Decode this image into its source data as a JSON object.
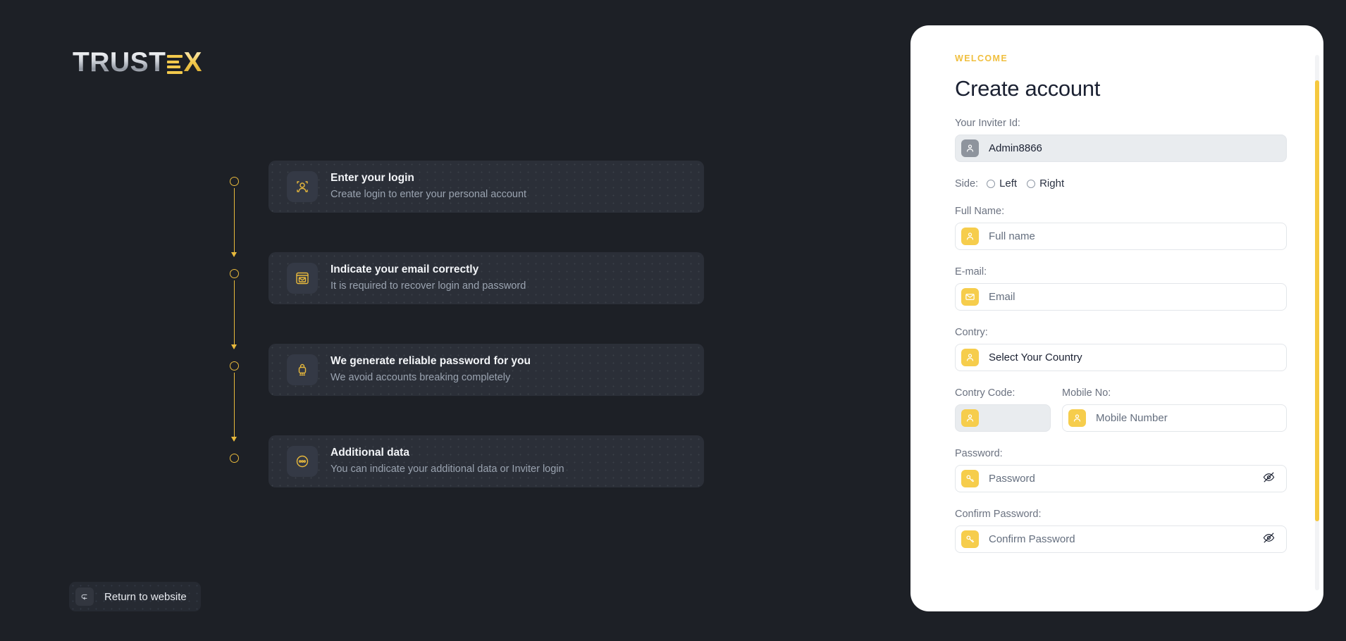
{
  "brand": {
    "name_main": "TRUST",
    "name_accent": "X",
    "logo_icon": "trustex-logo"
  },
  "left_panel": {
    "steps": [
      {
        "icon": "id-person-icon",
        "title": "Enter your login",
        "subtitle": "Create login to enter your personal account"
      },
      {
        "icon": "email-window-icon",
        "title": "Indicate your email correctly",
        "subtitle": "It is required to recover login and password"
      },
      {
        "icon": "padlock-asterisk-icon",
        "title": "We generate reliable password for you",
        "subtitle": "We avoid accounts breaking completely"
      },
      {
        "icon": "three-dots-circle-icon",
        "title": "Additional data",
        "subtitle": "You can indicate your additional data or Inviter login"
      }
    ],
    "return_button": {
      "label": "Return to website",
      "icon": "return-arrow-icon"
    }
  },
  "form": {
    "eyebrow": "WELCOME",
    "title": "Create account",
    "fields": {
      "inviter": {
        "label": "Your Inviter Id:",
        "value": "Admin8866",
        "icon": "person-icon",
        "disabled": true
      },
      "side": {
        "label": "Side:",
        "options": [
          {
            "label": "Left",
            "selected": false
          },
          {
            "label": "Right",
            "selected": false
          }
        ]
      },
      "full_name": {
        "label": "Full Name:",
        "placeholder": "Full name",
        "icon": "person-icon"
      },
      "email": {
        "label": "E-mail:",
        "placeholder": "Email",
        "icon": "envelope-icon"
      },
      "country": {
        "label": "Contry:",
        "value": "Select Your Country",
        "icon": "person-icon"
      },
      "country_code": {
        "label": "Contry Code:",
        "value": "",
        "icon": "person-icon",
        "disabled": true
      },
      "mobile": {
        "label": "Mobile No:",
        "placeholder": "Mobile Number",
        "icon": "person-icon"
      },
      "password": {
        "label": "Password:",
        "placeholder": "Password",
        "icon": "key-icon",
        "toggle_icon": "eye-off-icon"
      },
      "confirm_password": {
        "label": "Confirm Password:",
        "placeholder": "Confirm Password",
        "icon": "key-icon",
        "toggle_icon": "eye-off-icon"
      }
    }
  },
  "colors": {
    "background": "#1d2026",
    "card_dark": "#2b2f38",
    "accent_yellow": "#f2c94c",
    "field_icon_yellow": "#f6cd4c",
    "title_dark": "#1b2132",
    "label_gray": "#6b7280",
    "scrollbar_thumb": "#f5c83f"
  }
}
